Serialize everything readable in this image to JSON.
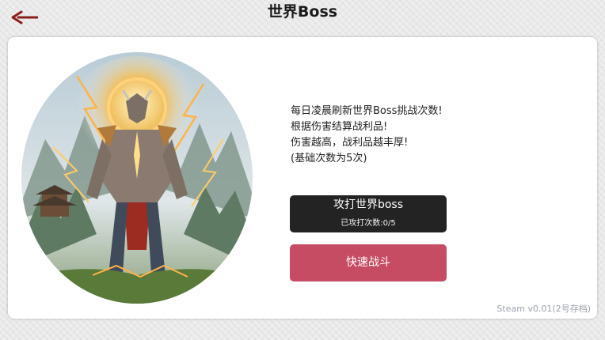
{
  "header": {
    "title": "世界Boss"
  },
  "icons": {
    "back": "back-arrow-icon"
  },
  "colors": {
    "attack_button": "#232323",
    "fast_battle_button": "#c54c63",
    "version_text": "#9aa3ad"
  },
  "boss": {
    "image": "boss-portrait-lightning-warrior"
  },
  "description": {
    "lines": [
      "每日凌晨刷新世界Boss挑战次数!",
      "根据伤害结算战利品!",
      "伤害越高，战利品越丰厚!",
      "(基础次数为5次)"
    ]
  },
  "actions": {
    "attack_label": "攻打世界boss",
    "attack_count": "已攻打次数:0/5",
    "fast_battle_label": "快速战斗"
  },
  "footer": {
    "version": "Steam v0.01(2号存档)"
  }
}
